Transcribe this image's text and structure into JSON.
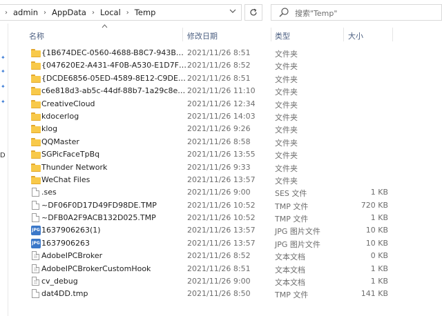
{
  "address": {
    "crumbs": [
      "admin",
      "AppData",
      "Local",
      "Temp"
    ],
    "separator": "›",
    "dropdown_icon": "chevron-down-icon",
    "refresh_icon": "refresh-icon"
  },
  "search": {
    "placeholder": "搜索\"Temp\"",
    "icon": "search-icon"
  },
  "left_nav": {
    "label": "D"
  },
  "columns": {
    "name": "名称",
    "date": "修改日期",
    "type": "类型",
    "size": "大小"
  },
  "files": [
    {
      "name": "{1B674DEC-0560-4688-B8C7-943B13...",
      "date": "2021/11/26 8:51",
      "type": "文件夹",
      "size": "",
      "icon": "folder-icon"
    },
    {
      "name": "{047620E2-A431-4F0B-A530-E1D7FDF...",
      "date": "2021/11/26 8:52",
      "type": "文件夹",
      "size": "",
      "icon": "folder-icon"
    },
    {
      "name": "{DCDE6856-05ED-4589-8E12-C9DE45...",
      "date": "2021/11/26 8:51",
      "type": "文件夹",
      "size": "",
      "icon": "folder-icon"
    },
    {
      "name": "c6e818d3-ab5c-44df-88b7-1a29c8ed...",
      "date": "2021/11/26 11:10",
      "type": "文件夹",
      "size": "",
      "icon": "folder-icon"
    },
    {
      "name": "CreativeCloud",
      "date": "2021/11/26 12:34",
      "type": "文件夹",
      "size": "",
      "icon": "folder-icon"
    },
    {
      "name": "kdocerlog",
      "date": "2021/11/26 14:03",
      "type": "文件夹",
      "size": "",
      "icon": "folder-icon"
    },
    {
      "name": "klog",
      "date": "2021/11/26 9:26",
      "type": "文件夹",
      "size": "",
      "icon": "folder-icon"
    },
    {
      "name": "QQMaster",
      "date": "2021/11/26 8:58",
      "type": "文件夹",
      "size": "",
      "icon": "folder-icon"
    },
    {
      "name": "SGPicFaceTpBq",
      "date": "2021/11/26 13:55",
      "type": "文件夹",
      "size": "",
      "icon": "folder-icon"
    },
    {
      "name": "Thunder Network",
      "date": "2021/11/26 9:33",
      "type": "文件夹",
      "size": "",
      "icon": "folder-icon"
    },
    {
      "name": "WeChat Files",
      "date": "2021/11/26 13:57",
      "type": "文件夹",
      "size": "",
      "icon": "folder-icon"
    },
    {
      "name": ".ses",
      "date": "2021/11/26 9:00",
      "type": "SES 文件",
      "size": "1 KB",
      "icon": "file-icon"
    },
    {
      "name": "~DF06F0D17D49FD98DE.TMP",
      "date": "2021/11/26 10:52",
      "type": "TMP 文件",
      "size": "720 KB",
      "icon": "file-icon"
    },
    {
      "name": "~DFB0A2F9ACB132D025.TMP",
      "date": "2021/11/26 10:52",
      "type": "TMP 文件",
      "size": "1 KB",
      "icon": "file-icon"
    },
    {
      "name": "1637906263(1)",
      "date": "2021/11/26 13:57",
      "type": "JPG 图片文件",
      "size": "10 KB",
      "icon": "jpg-icon"
    },
    {
      "name": "1637906263",
      "date": "2021/11/26 13:57",
      "type": "JPG 图片文件",
      "size": "10 KB",
      "icon": "jpg-icon"
    },
    {
      "name": "AdobeIPCBroker",
      "date": "2021/11/26 8:52",
      "type": "文本文档",
      "size": "0 KB",
      "icon": "text-file-icon"
    },
    {
      "name": "AdobeIPCBrokerCustomHook",
      "date": "2021/11/26 8:51",
      "type": "文本文档",
      "size": "1 KB",
      "icon": "text-file-icon"
    },
    {
      "name": "cv_debug",
      "date": "2021/11/26 9:00",
      "type": "文本文档",
      "size": "1 KB",
      "icon": "text-file-icon"
    },
    {
      "name": "dat4DD.tmp",
      "date": "2021/11/26 8:50",
      "type": "TMP 文件",
      "size": "141 KB",
      "icon": "file-icon"
    }
  ],
  "colors": {
    "folder": "#f8c94a",
    "jpg_badge": "#3b78c9",
    "header_text": "#4d6082",
    "pin": "#3a7bd5"
  }
}
